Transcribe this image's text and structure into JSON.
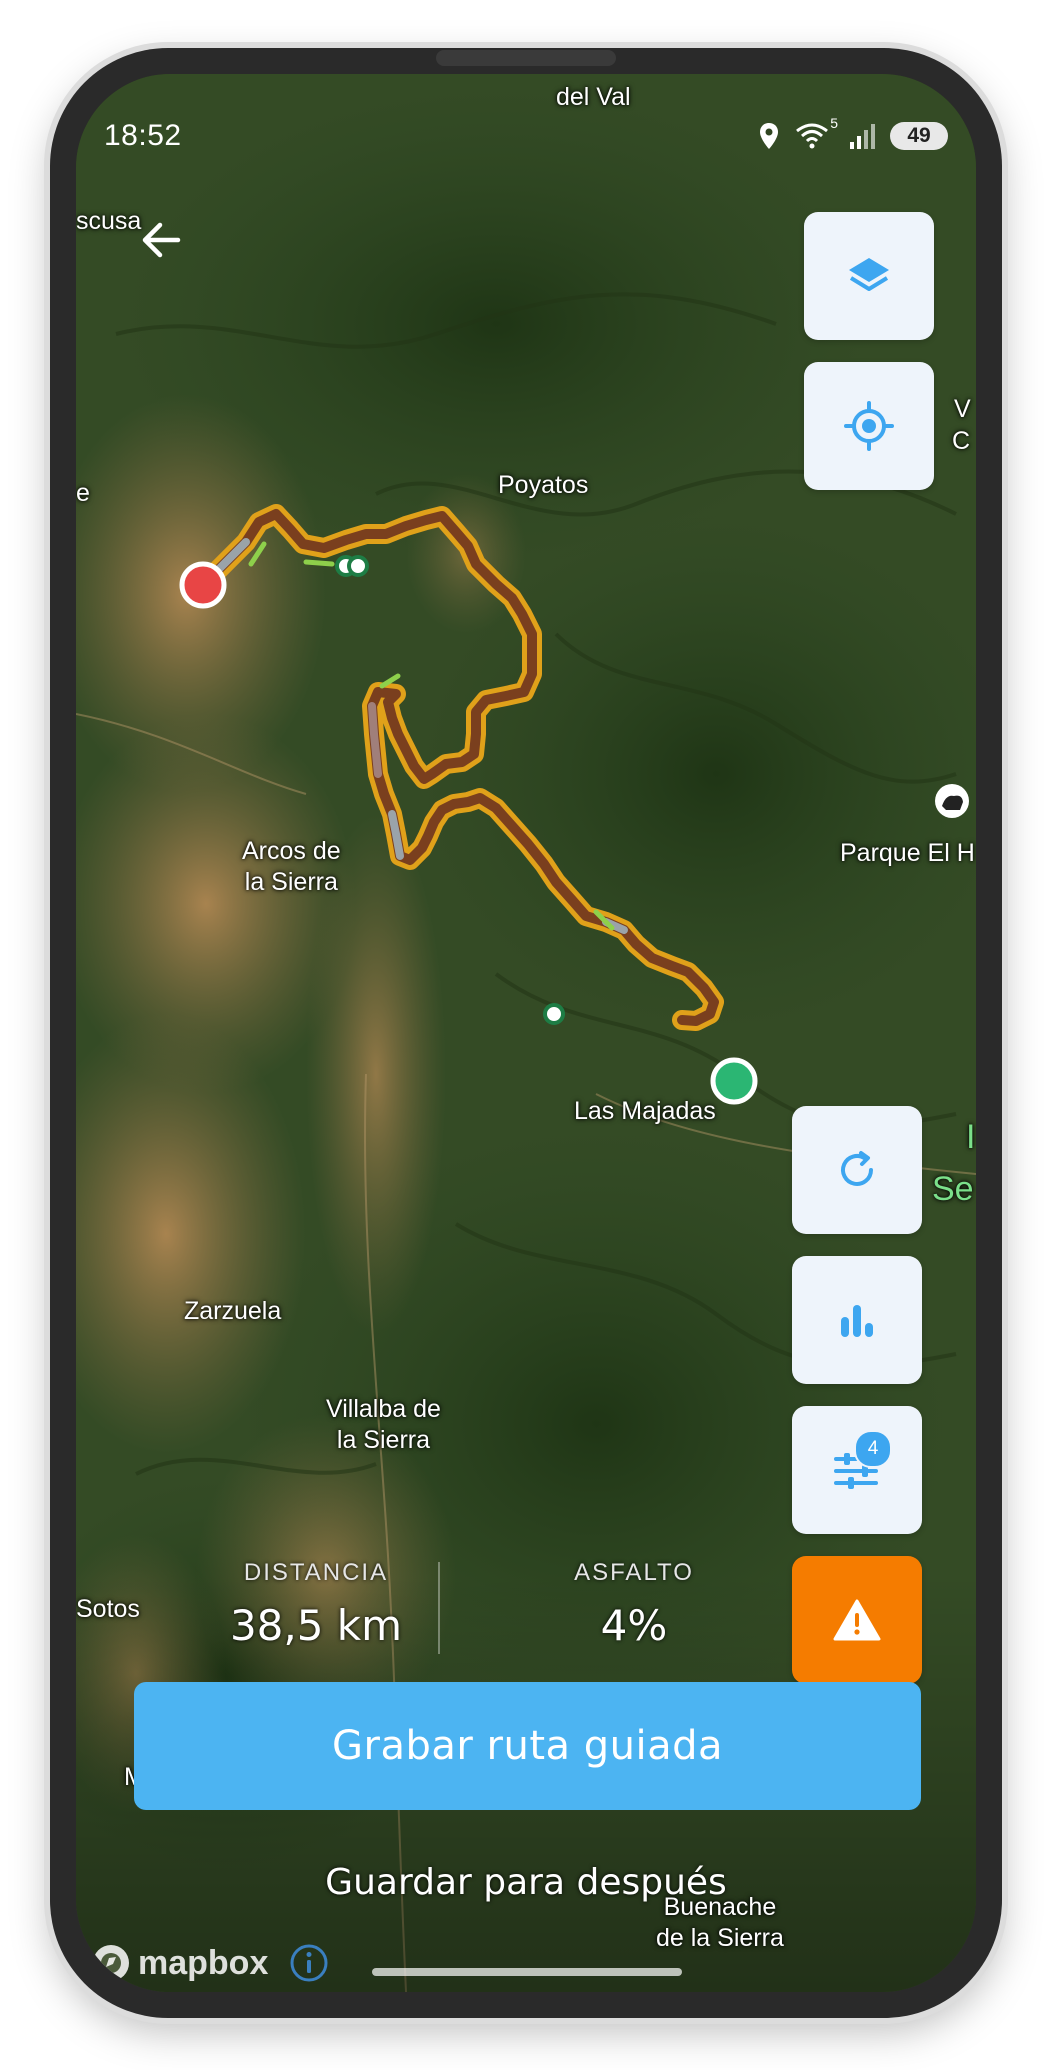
{
  "status_bar": {
    "time": "18:52",
    "icons": [
      "location-pin-icon",
      "wifi-icon",
      "signal-icon"
    ],
    "wifi_badge": "5",
    "battery": "49"
  },
  "map": {
    "provider": "mapbox",
    "places": {
      "del_val": "del Val",
      "escusa": "scusa",
      "left_edge": "e",
      "poyatos": "Poyatos",
      "right_v": "V",
      "right_c": "C",
      "arcos_line1": "Arcos de",
      "arcos_line2": "la Sierra",
      "parque": "Parque El H",
      "las_majadas": "Las Majadas",
      "right_green_1": "I",
      "right_green_2": "Se",
      "zarzuela": "Zarzuela",
      "villalba_line1": "Villalba de",
      "villalba_line2": "la Sierra",
      "sotos": "Sotos",
      "left_m": "M",
      "buenache_line1": "Buenache",
      "buenache_line2": "de la Sierra"
    },
    "route_colors": {
      "casing": "#e0a11a",
      "core": "#7a3f1e",
      "paved": "#9aa3a9",
      "path": "#8ed04b",
      "start": "#2bb673",
      "end": "#e84545"
    }
  },
  "controls": {
    "back": "arrow-left-icon",
    "layers": "layers-icon",
    "locate": "locate-icon",
    "refresh": "refresh-icon",
    "elevation": "bar-chart-icon",
    "filters": "sliders-icon",
    "filters_badge": "4",
    "warning": "warning-icon",
    "colors": {
      "panel": "#eef4fb",
      "icon": "#3da6f0",
      "warning": "#f57c00"
    }
  },
  "stats": {
    "distance_label": "DISTANCIA",
    "distance_value": "38,5 km",
    "asphalt_label": "ASFALTO",
    "asphalt_value": "4%"
  },
  "actions": {
    "primary": "Grabar ruta guiada",
    "primary_color": "#4cb4f2",
    "secondary": "Guardar para después"
  },
  "attribution": {
    "logo_text": "mapbox"
  }
}
